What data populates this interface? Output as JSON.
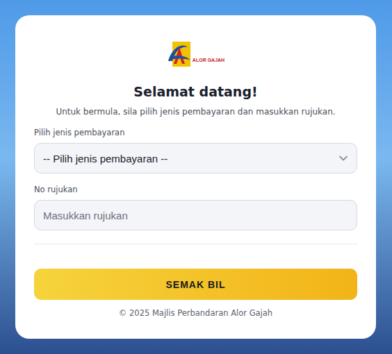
{
  "logo": {
    "text": "ALOR GAJAH"
  },
  "title": "Selamat datang!",
  "subtitle": "Untuk bermula, sila pilih jenis pembayaran dan masukkan rujukan.",
  "payment_type": {
    "label": "Pilih jenis pembayaran",
    "value": "-- Pilih jenis pembayaran --"
  },
  "reference": {
    "label": "No rujukan",
    "placeholder": "Masukkan rujukan"
  },
  "button": "SEMAK BIL",
  "footer": "© 2025 Majlis Perbandaran Alor Gajah"
}
